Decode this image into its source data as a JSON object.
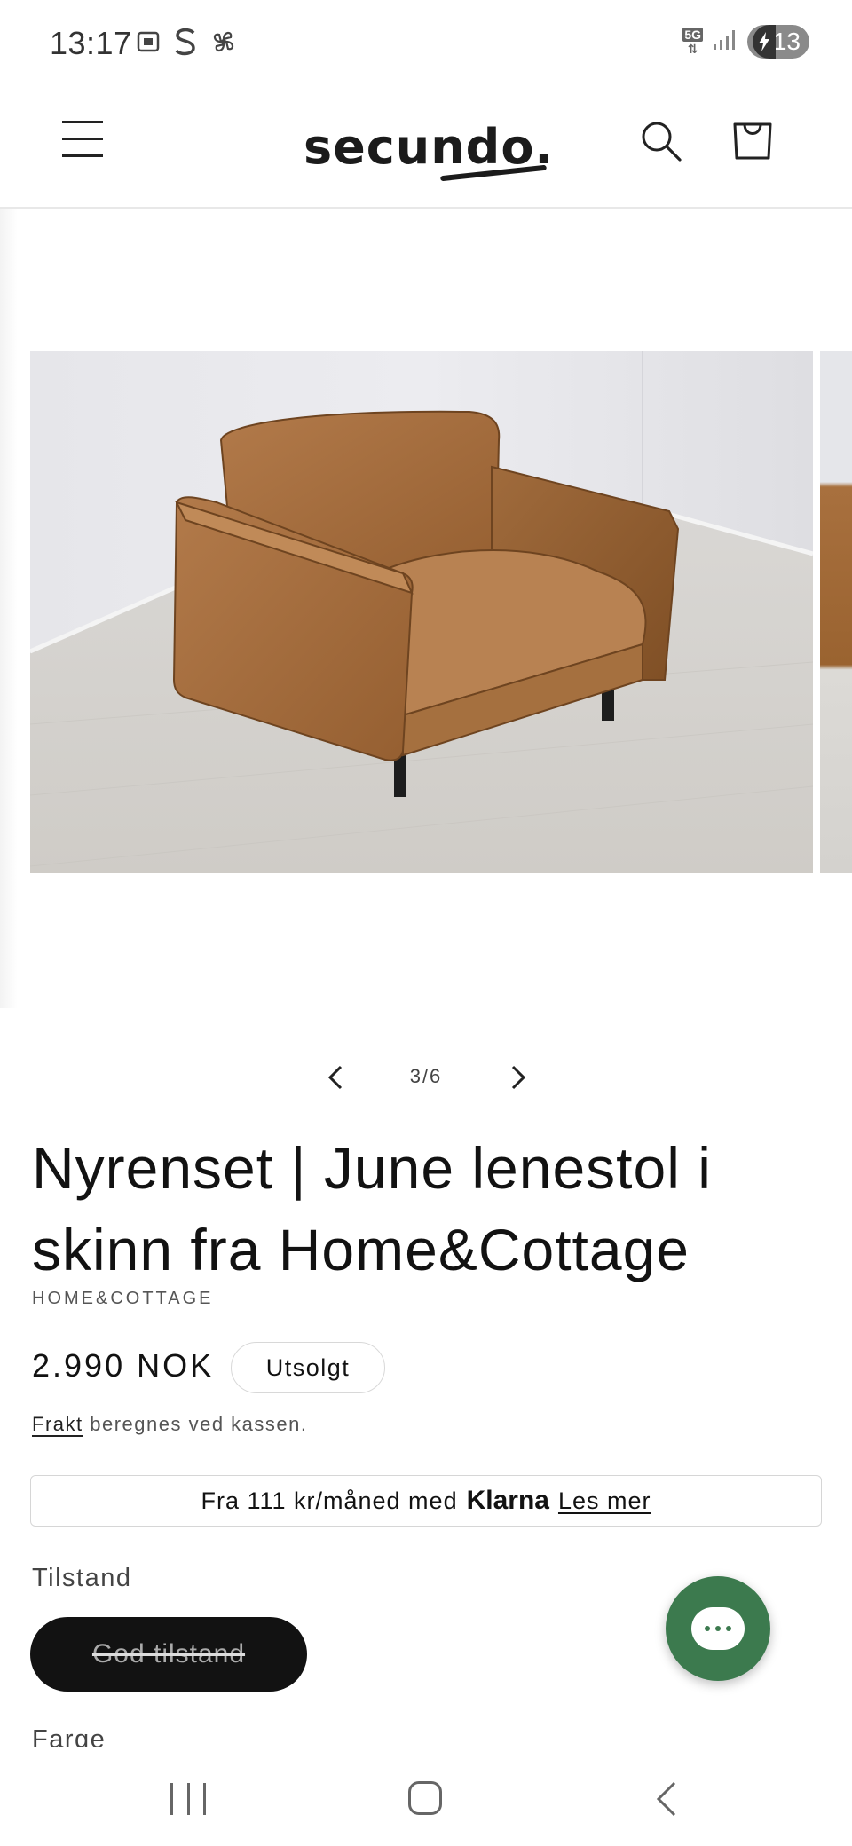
{
  "status_bar": {
    "time": "13:17",
    "left_icons": [
      "screenshot-icon",
      "s-app-icon",
      "pinwheel-icon"
    ],
    "network": "5G",
    "battery": "13"
  },
  "header": {
    "logo_text": "secundo.",
    "icons": [
      "menu-icon",
      "search-icon",
      "cart-icon"
    ]
  },
  "gallery": {
    "counter": "3/6",
    "current_image": "brown-leather-armchair"
  },
  "product": {
    "title": "Nyrenset | June lenestol i skinn fra Home&Cottage",
    "vendor": "HOME&COTTAGE",
    "price": "2.990 NOK",
    "sold_badge": "Utsolgt",
    "shipping_link": "Frakt",
    "shipping_text": " beregnes ved kassen."
  },
  "klarna": {
    "text": "Fra 111 kr/måned med",
    "brand": "Klarna",
    "link": "Les mer"
  },
  "options": {
    "condition_label": "Tilstand",
    "condition_value": "God tilstand",
    "color_label": "Farge"
  },
  "colors": {
    "chat_button": "#3c7a4e",
    "pill_bg": "#121212"
  }
}
